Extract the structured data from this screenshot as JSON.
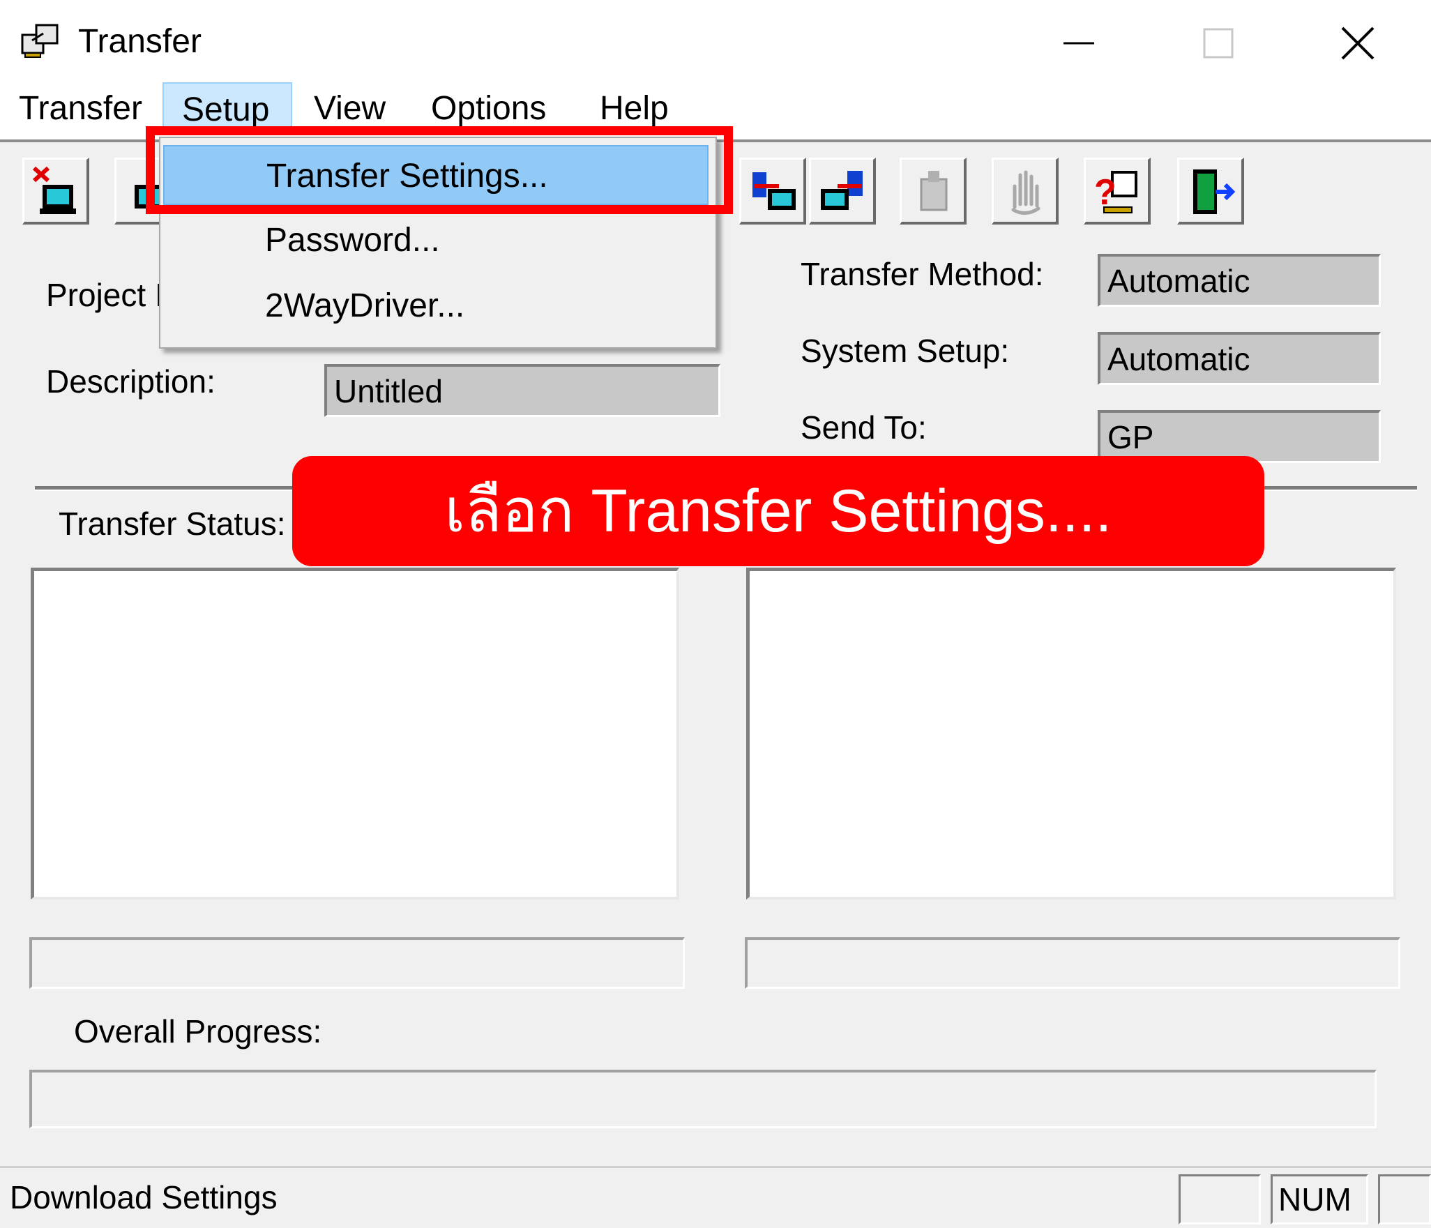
{
  "window": {
    "title": "Transfer",
    "controls": {
      "minimize": "minimize-icon",
      "maximize": "maximize-icon",
      "close": "close-icon"
    }
  },
  "menubar": {
    "items": [
      {
        "label": "Transfer"
      },
      {
        "label": "Setup",
        "active": true
      },
      {
        "label": "View"
      },
      {
        "label": "Options"
      },
      {
        "label": "Help"
      }
    ]
  },
  "setup_menu": {
    "items": [
      {
        "label": "Transfer Settings...",
        "highlighted": true
      },
      {
        "label": "Password..."
      },
      {
        "label": "2WayDriver..."
      }
    ]
  },
  "toolbar": {
    "buttons": [
      {
        "icon": "download-to-gp-icon"
      },
      {
        "icon": "upload-from-gp-icon"
      },
      {
        "icon": "send-project-icon"
      },
      {
        "icon": "receive-project-icon"
      },
      {
        "icon": "compare-icon"
      },
      {
        "icon": "stop-hand-icon"
      },
      {
        "icon": "help-icon"
      },
      {
        "icon": "exit-icon"
      }
    ]
  },
  "fields": {
    "project_label": "Project I",
    "description_label": "Description:",
    "description_value": "Untitled",
    "transfer_method_label": "Transfer Method:",
    "transfer_method_value": "Automatic",
    "system_setup_label": "System Setup:",
    "system_setup_value": "Automatic",
    "send_to_label": "Send To:",
    "send_to_value": "GP"
  },
  "transfer_status": {
    "label": "Transfer Status:"
  },
  "overall_progress": {
    "label": "Overall Progress:",
    "value": 0
  },
  "statusbar": {
    "text": "Download Settings",
    "panes": [
      "",
      "NUM",
      ""
    ]
  },
  "annotation": {
    "callout_text": "เลือก Transfer Settings....",
    "highlight_color": "#ff0000"
  }
}
